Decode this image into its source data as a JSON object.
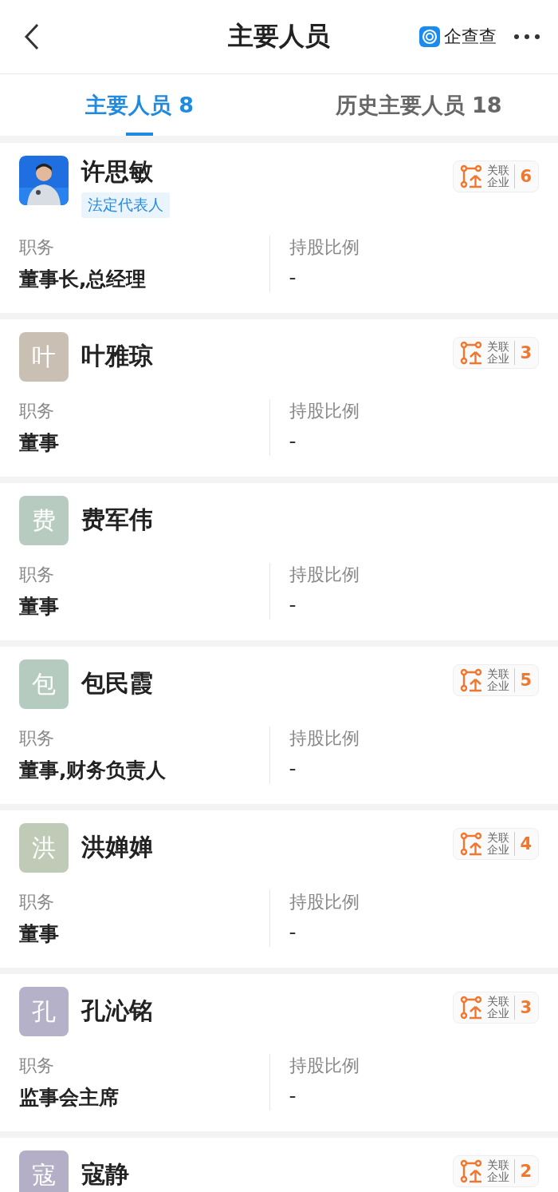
{
  "header": {
    "title": "主要人员",
    "brand": "企查查"
  },
  "tabs": [
    {
      "label": "主要人员 8",
      "selected": true
    },
    {
      "label": "历史主要人员 18",
      "selected": false
    }
  ],
  "people": [
    {
      "name": "许思敏",
      "tag": "法定代表人",
      "related": {
        "label": "关联",
        "label2": "企业",
        "count": "6"
      },
      "fields": [
        {
          "label": "职务",
          "value": "董事长,总经理"
        },
        {
          "label": "持股比例",
          "value": "-"
        }
      ]
    },
    {
      "avatar": {
        "kind": "initial",
        "text": "叶",
        "color": "#c9bfb3"
      },
      "name": "叶雅琼",
      "related": {
        "label": "关联",
        "label2": "企业",
        "count": "3"
      },
      "fields": [
        {
          "label": "职务",
          "value": "董事"
        },
        {
          "label": "持股比例",
          "value": "-"
        }
      ]
    },
    {
      "avatar": {
        "kind": "initial",
        "text": "费",
        "color": "#b8cbc1"
      },
      "name": "费军伟",
      "fields": [
        {
          "label": "职务",
          "value": "董事"
        },
        {
          "label": "持股比例",
          "value": "-"
        }
      ]
    },
    {
      "avatar": {
        "kind": "initial",
        "text": "包",
        "color": "#b6cbbf"
      },
      "name": "包民霞",
      "related": {
        "label": "关联",
        "label2": "企业",
        "count": "5"
      },
      "fields": [
        {
          "label": "职务",
          "value": "董事,财务负责人"
        },
        {
          "label": "持股比例",
          "value": "-"
        }
      ]
    },
    {
      "avatar": {
        "kind": "initial",
        "text": "洪",
        "color": "#bfcbb6"
      },
      "name": "洪婵婵",
      "related": {
        "label": "关联",
        "label2": "企业",
        "count": "4"
      },
      "fields": [
        {
          "label": "职务",
          "value": "董事"
        },
        {
          "label": "持股比例",
          "value": "-"
        }
      ]
    },
    {
      "avatar": {
        "kind": "initial",
        "text": "孔",
        "color": "#b5b1c8"
      },
      "name": "孔沁铭",
      "related": {
        "label": "关联",
        "label2": "企业",
        "count": "3"
      },
      "fields": [
        {
          "label": "职务",
          "value": "监事会主席"
        },
        {
          "label": "持股比例",
          "value": "-"
        }
      ]
    },
    {
      "avatar": {
        "kind": "initial",
        "text": "寇",
        "color": "#b4afc6"
      },
      "name": "寇静",
      "related": {
        "label": "关联",
        "label2": "企业",
        "count": "2"
      }
    }
  ]
}
